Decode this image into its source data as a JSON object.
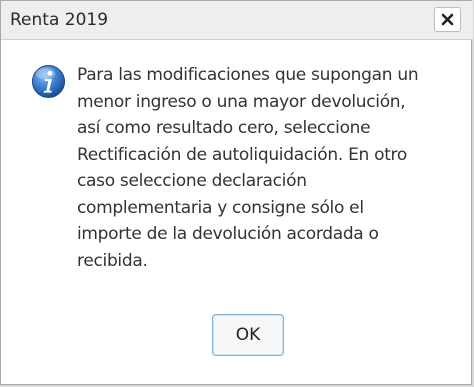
{
  "dialog": {
    "title": "Renta 2019",
    "close_icon": "close-icon",
    "info_icon": "info-icon",
    "message_lines": [
      "Para las modificaciones que supongan un",
      "menor ingreso o una mayor devolución,",
      "así como resultado cero, seleccione",
      "Rectificación de autoliquidación. En otro",
      "caso seleccione declaración",
      "complementaria y consigne sólo el",
      "importe de la devolución acordada o",
      "recibida."
    ],
    "ok_label": "OK"
  },
  "colors": {
    "titlebar": "#eeeeee",
    "dialog_background": "#ffffff",
    "info_icon_blue": "#2f6fc0",
    "ok_border": "#7fb0d6"
  }
}
